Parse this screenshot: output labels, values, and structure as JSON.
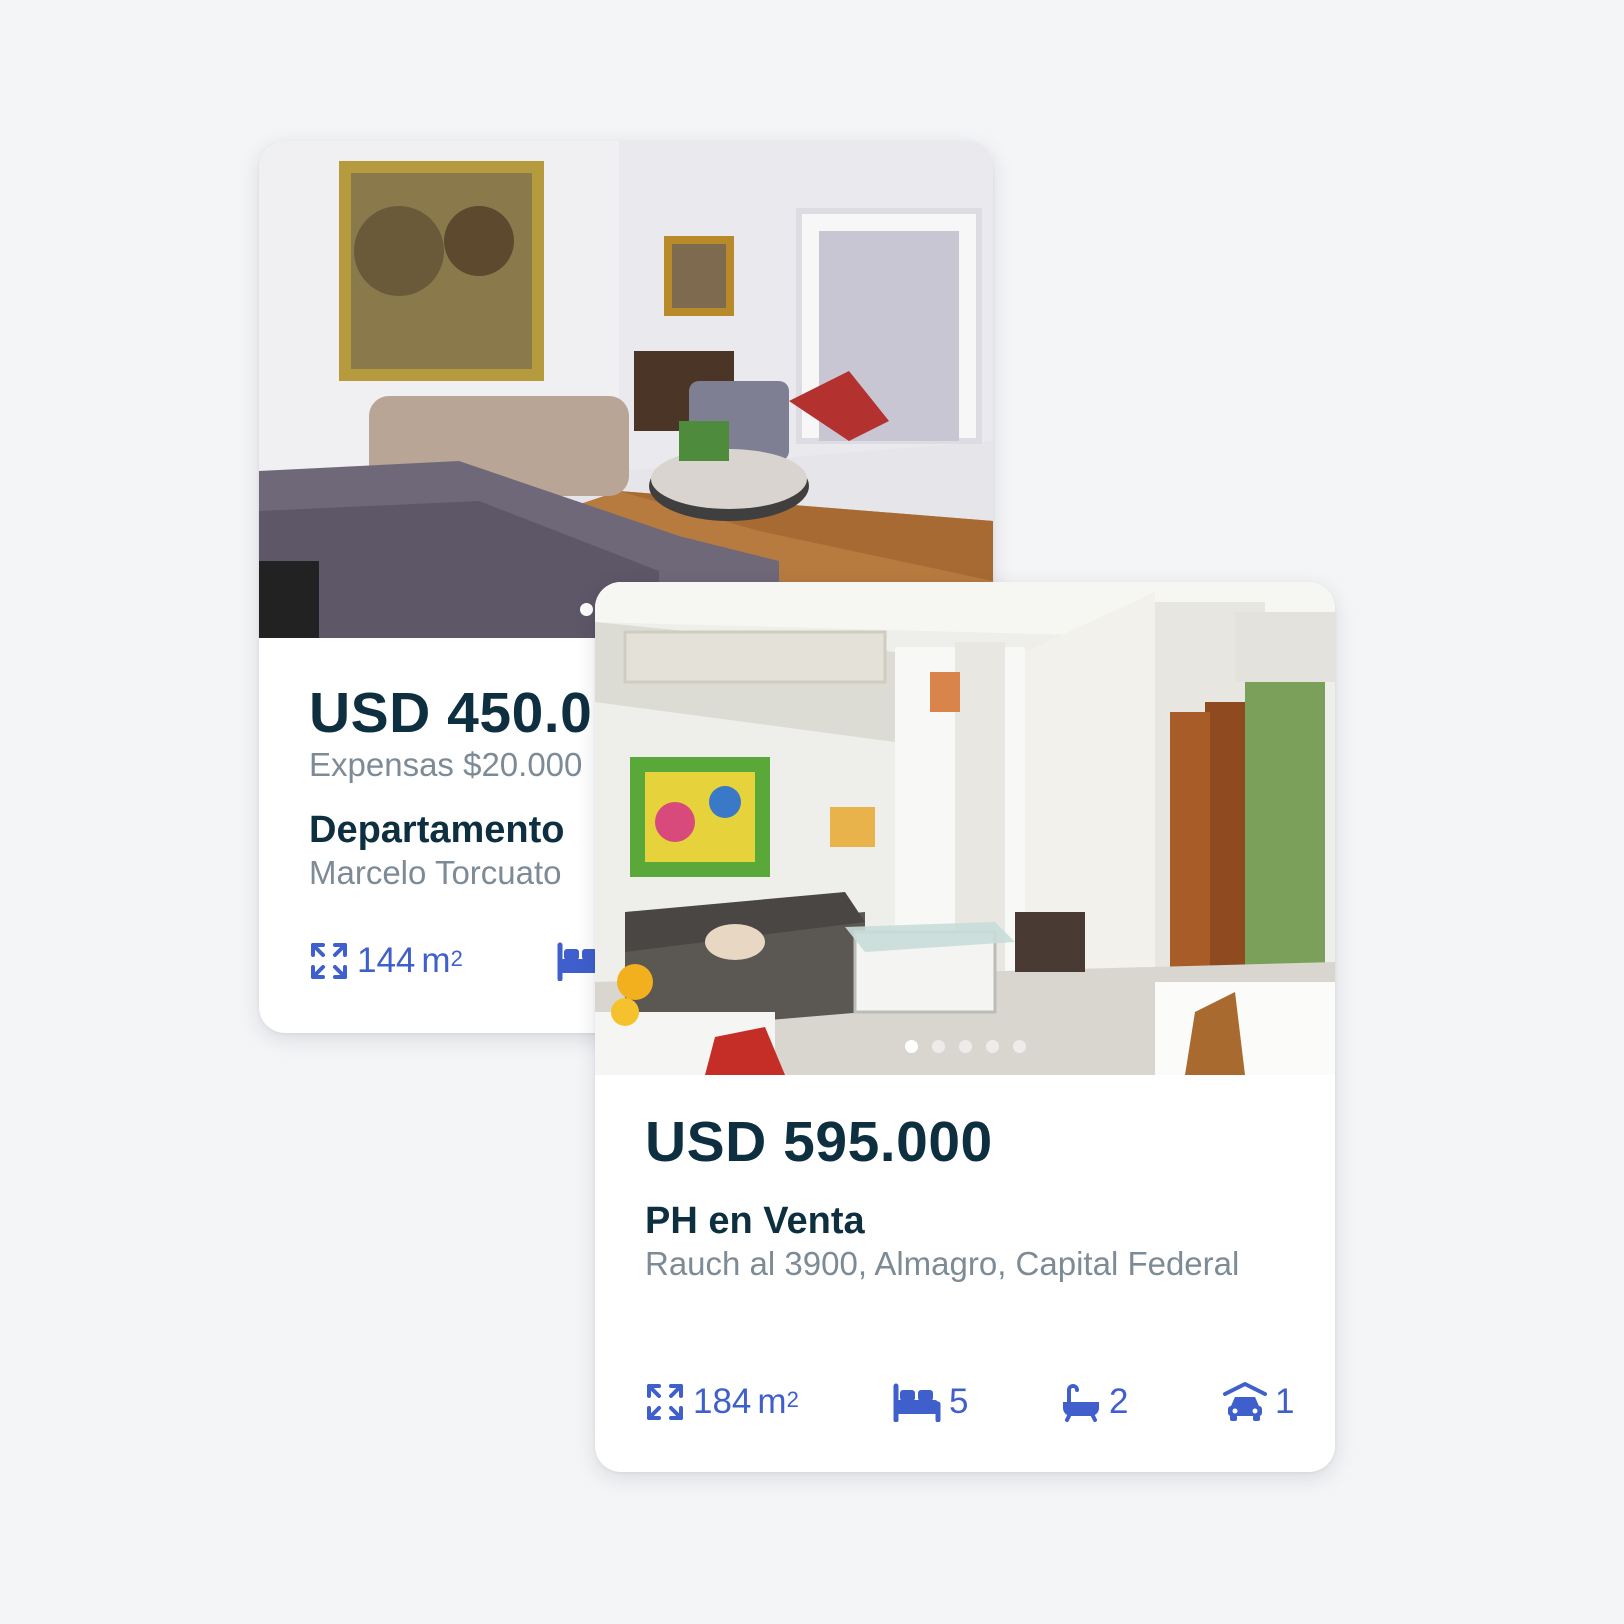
{
  "colors": {
    "background": "#f4f5f7",
    "price_text": "#0e2f3f",
    "secondary_text": "#7d8b97",
    "feature_accent": "#3f5fcc"
  },
  "listings": [
    {
      "price": "USD 450.0",
      "expensas": "Expensas $20.000",
      "property_type": "Departamento",
      "address": "Marcelo Torcuato",
      "carousel": {
        "total_dots": 2,
        "active_index": 0
      },
      "features": {
        "area_value": "144",
        "area_unit": "m",
        "area_sup": "2",
        "area_icon": "expand-arrows-icon",
        "bed_icon": "bed-icon"
      }
    },
    {
      "price": "USD 595.000",
      "property_type": "PH en Venta",
      "address": "Rauch al 3900, Almagro, Capital Federal",
      "carousel": {
        "total_dots": 5,
        "active_index": 0
      },
      "features": {
        "area_value": "184",
        "area_unit": "m",
        "area_sup": "2",
        "bedrooms": "5",
        "bathrooms": "2",
        "parking": "1",
        "icons": [
          "expand-arrows-icon",
          "bed-icon",
          "bathtub-icon",
          "car-garage-icon"
        ]
      }
    }
  ]
}
